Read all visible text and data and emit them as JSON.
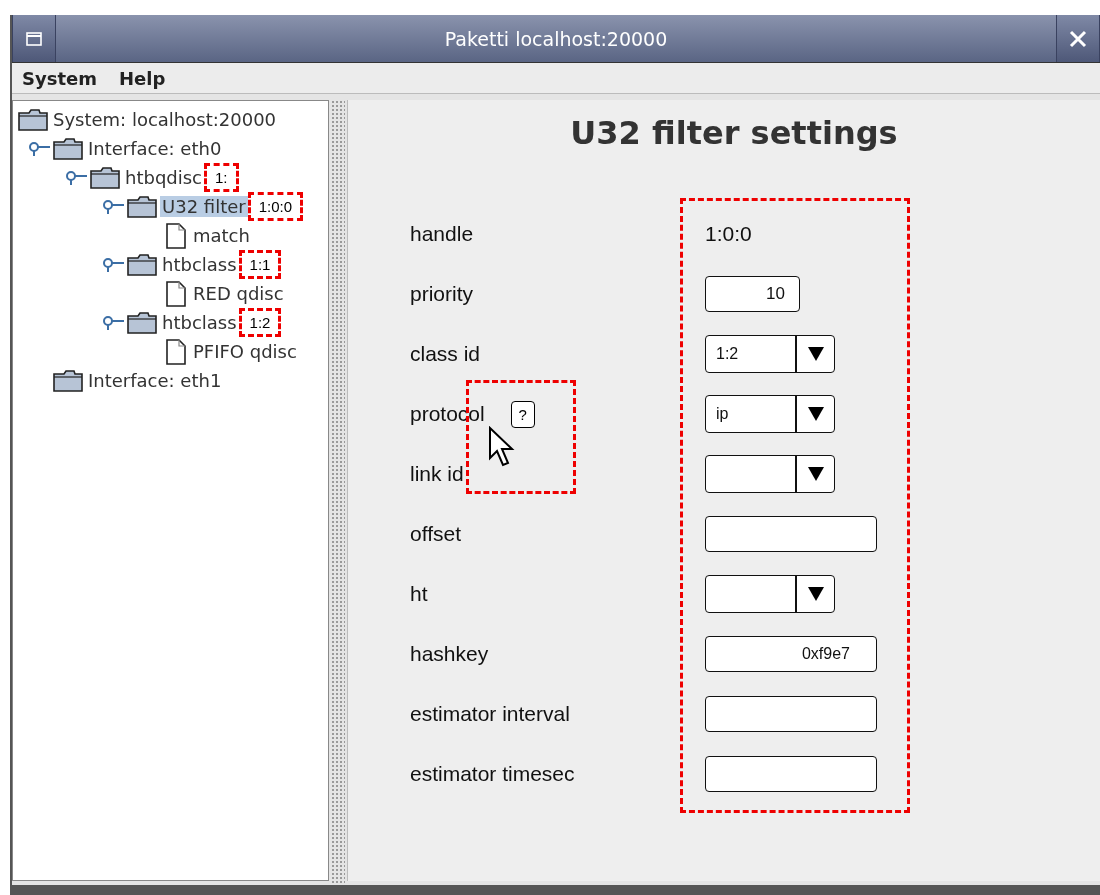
{
  "window": {
    "title": "Paketti localhost:20000"
  },
  "menu": [
    {
      "label": "System"
    },
    {
      "label": "Help"
    }
  ],
  "tree": {
    "label": "System: localhost:20000",
    "kind": "folder",
    "selected": false,
    "children": [
      {
        "label": "Interface: eth0",
        "kind": "folder",
        "selected": false,
        "children": [
          {
            "label": "htbqdisc",
            "kind": "folder",
            "selected": false,
            "annotation": "1:",
            "children": [
              {
                "label": "U32 filter",
                "kind": "folder",
                "selected": true,
                "annotation": "1:0:0",
                "children": [
                  {
                    "label": "match",
                    "kind": "file",
                    "selected": false
                  }
                ]
              },
              {
                "label": "htbclass",
                "kind": "folder",
                "selected": false,
                "annotation": "1:1",
                "children": [
                  {
                    "label": "RED qdisc",
                    "kind": "file",
                    "selected": false
                  }
                ]
              },
              {
                "label": "htbclass",
                "kind": "folder",
                "selected": false,
                "annotation": "1:2",
                "children": [
                  {
                    "label": "PFIFO qdisc",
                    "kind": "file",
                    "selected": false
                  }
                ]
              }
            ]
          }
        ]
      },
      {
        "label": "Interface: eth1",
        "kind": "folder",
        "selected": false
      }
    ]
  },
  "panel": {
    "title": "U32 filter settings",
    "help": "?",
    "fields": [
      {
        "label": "handle",
        "kind": "text",
        "value": "1:0:0"
      },
      {
        "label": "priority",
        "kind": "short",
        "value": "10"
      },
      {
        "label": "class id",
        "kind": "combo",
        "value": "1:2"
      },
      {
        "label": "protocol",
        "kind": "combo",
        "value": "ip",
        "help": true
      },
      {
        "label": "link id",
        "kind": "combo"
      },
      {
        "label": "offset",
        "kind": "input"
      },
      {
        "label": "ht",
        "kind": "combo"
      },
      {
        "label": "hashkey",
        "kind": "input",
        "value": "0xf9e7"
      },
      {
        "label": "estimator interval",
        "kind": "input"
      },
      {
        "label": "estimator timesec",
        "kind": "input"
      }
    ]
  }
}
